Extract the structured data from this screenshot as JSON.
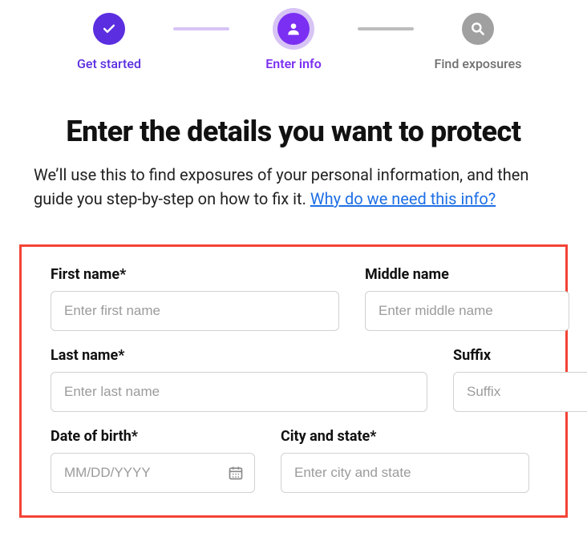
{
  "stepper": {
    "steps": [
      {
        "label": "Get started",
        "state": "done"
      },
      {
        "label": "Enter info",
        "state": "active"
      },
      {
        "label": "Find exposures",
        "state": "pending"
      }
    ]
  },
  "heading": "Enter the details you want to protect",
  "lead_pre": "We’ll use this to find exposures of your personal information, and then guide you step-by-step on how to fix it. ",
  "lead_link": "Why do we need this info?",
  "form": {
    "first_name": {
      "label": "First name*",
      "placeholder": "Enter first name",
      "value": ""
    },
    "middle_name": {
      "label": "Middle name",
      "placeholder": "Enter middle name",
      "value": ""
    },
    "last_name": {
      "label": "Last  name*",
      "placeholder": "Enter last name",
      "value": ""
    },
    "suffix": {
      "label": "Suffix",
      "placeholder": "Suffix",
      "value": ""
    },
    "dob": {
      "label": "Date of birth*",
      "placeholder": "MM/DD/YYYY",
      "value": ""
    },
    "city_state": {
      "label": "City and state*",
      "placeholder": "Enter city and state",
      "value": ""
    }
  }
}
